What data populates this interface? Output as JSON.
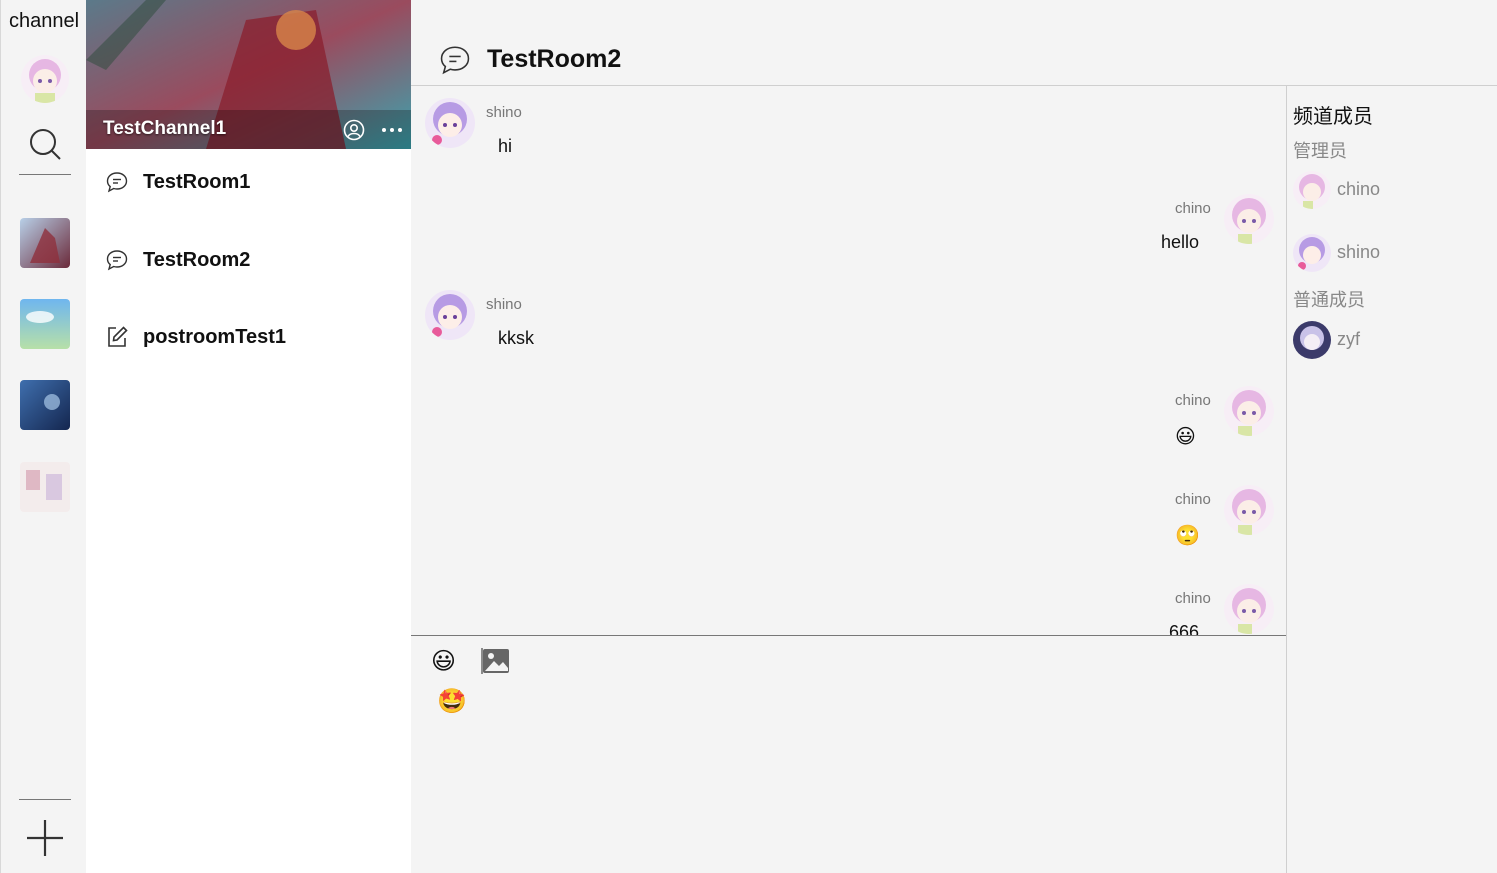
{
  "rail": {
    "title": "channel",
    "icons": [
      "search-icon",
      "plus-icon"
    ],
    "channels": [
      {
        "name": "channel-thumb-1",
        "colors": [
          "#6b2a3a",
          "#b8d0e8"
        ]
      },
      {
        "name": "channel-thumb-2",
        "colors": [
          "#6fb6ef",
          "#b7e0a8"
        ]
      },
      {
        "name": "channel-thumb-3",
        "colors": [
          "#14264f",
          "#3f6fae"
        ]
      },
      {
        "name": "channel-thumb-4",
        "colors": [
          "#f3ecec",
          "#d6a3b4"
        ]
      }
    ]
  },
  "channel": {
    "name": "TestChannel1",
    "rooms": [
      {
        "label": "TestRoom1",
        "icon": "chat-icon"
      },
      {
        "label": "TestRoom2",
        "icon": "chat-icon"
      },
      {
        "label": "postroomTest1",
        "icon": "edit-icon"
      }
    ]
  },
  "room": {
    "title": "TestRoom2"
  },
  "messages": [
    {
      "user": "shino",
      "text": "hi",
      "side": "left"
    },
    {
      "user": "chino",
      "text": "hello",
      "side": "right"
    },
    {
      "user": "shino",
      "text": "kksk",
      "side": "left"
    },
    {
      "user": "chino",
      "text": "😃",
      "side": "right"
    },
    {
      "user": "chino",
      "text": "🙄",
      "side": "right"
    },
    {
      "user": "chino",
      "text": "666",
      "side": "right"
    }
  ],
  "composer": {
    "emojis": [
      "😃",
      "🤩"
    ],
    "image_icon": "image-icon"
  },
  "members": {
    "title": "频道成员",
    "admin_label": "管理员",
    "admins": [
      "chino",
      "shino"
    ],
    "normal_label": "普通成员",
    "normal": [
      "zyf"
    ]
  },
  "colors": {
    "background": "#f4f4f4",
    "panel": "#ffffff",
    "muted_text": "#888888"
  }
}
